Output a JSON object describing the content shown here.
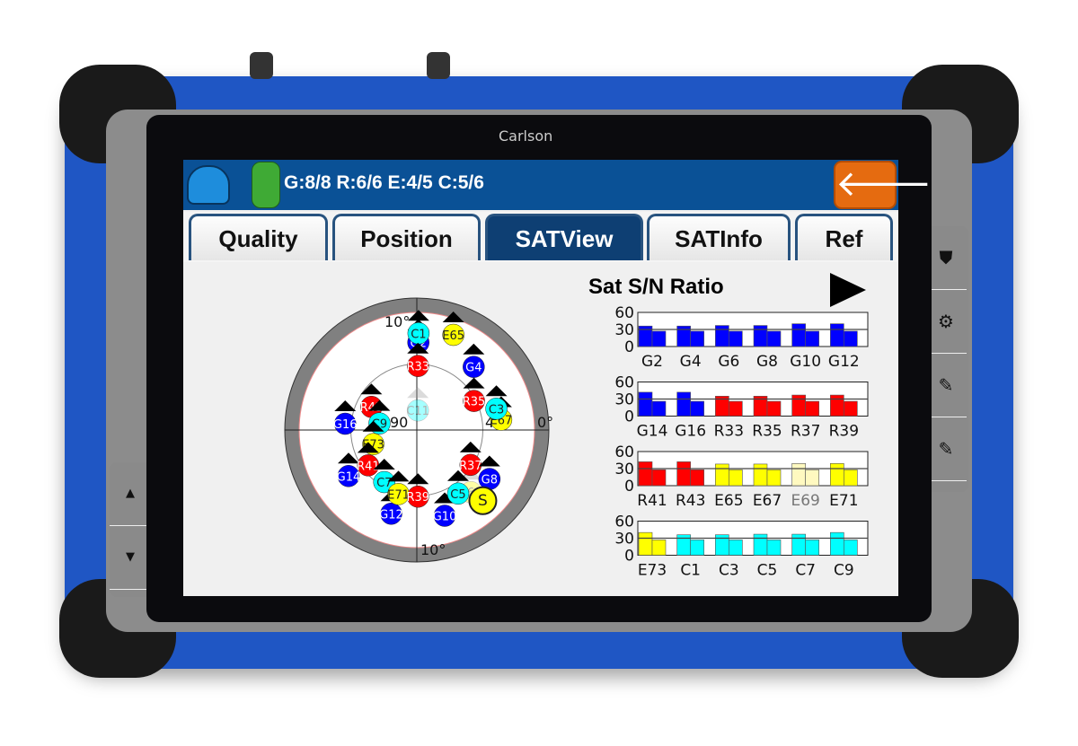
{
  "device": {
    "brand": "Carlson",
    "side_buttons": [
      {
        "icon": "shield-icon",
        "glyph": "⛊"
      },
      {
        "icon": "gear-icon",
        "glyph": "⚙"
      },
      {
        "icon": "edit-icon",
        "glyph": "✎"
      },
      {
        "icon": "edit-icon",
        "glyph": "✎"
      }
    ],
    "nav_buttons": [
      {
        "icon": "arrow-up-icon",
        "glyph": "▲"
      },
      {
        "icon": "arrow-down-icon",
        "glyph": "▼"
      }
    ]
  },
  "header": {
    "status": "G:8/8 R:6/6 E:4/5 C:5/6",
    "back_glyph": "🡐",
    "color": "#0a5196"
  },
  "tabs": [
    {
      "label": "Quality"
    },
    {
      "label": "Position"
    },
    {
      "label": "SATView",
      "active": true
    },
    {
      "label": "SATInfo"
    },
    {
      "label": "Ref"
    }
  ],
  "skyplot": {
    "labels": {
      "top": "10°",
      "bottom": "10°",
      "right": "0°",
      "center": "90",
      "inner": "45"
    },
    "colors": {
      "G": "#0000ff",
      "R": "#ff0000",
      "E": "#ffff00",
      "C": "#00ffff",
      "S": "#ffff00"
    },
    "satellites": [
      {
        "id": "G2",
        "az": 1,
        "el": 23
      },
      {
        "id": "C1",
        "az": 1,
        "el": 16
      },
      {
        "id": "E65",
        "az": 21,
        "el": 12
      },
      {
        "id": "R33",
        "az": 1,
        "el": 41
      },
      {
        "id": "G4",
        "az": 42,
        "el": 25
      },
      {
        "id": "R35",
        "az": 63,
        "el": 41
      },
      {
        "id": "E67",
        "az": 83,
        "el": 25
      },
      {
        "id": "C3",
        "az": 75,
        "el": 27
      },
      {
        "id": "C11",
        "az": 3,
        "el": 75,
        "faded": true
      },
      {
        "id": "G16",
        "az": 275,
        "el": 35
      },
      {
        "id": "R43",
        "az": 297,
        "el": 51
      },
      {
        "id": "C9",
        "az": 280,
        "el": 61
      },
      {
        "id": "E73",
        "az": 252,
        "el": 55
      },
      {
        "id": "G14",
        "az": 236,
        "el": 27
      },
      {
        "id": "R41",
        "az": 234,
        "el": 44
      },
      {
        "id": "C7",
        "az": 212,
        "el": 43
      },
      {
        "id": "G12",
        "az": 197,
        "el": 23
      },
      {
        "id": "E71",
        "az": 196,
        "el": 39
      },
      {
        "id": "R39",
        "az": 179,
        "el": 39
      },
      {
        "id": "G10",
        "az": 162,
        "el": 21
      },
      {
        "id": "E69",
        "az": 139,
        "el": 27,
        "faded": true
      },
      {
        "id": "C5",
        "az": 147,
        "el": 32
      },
      {
        "id": "R37",
        "az": 123,
        "el": 41
      },
      {
        "id": "G8",
        "az": 124,
        "el": 23
      },
      {
        "id": "S",
        "az": 137,
        "el": 16,
        "sbas": true
      }
    ]
  },
  "sn_chart": {
    "title": "Sat S/N Ratio",
    "next_glyph": "▶"
  },
  "chart_data": {
    "type": "bar",
    "title": "Sat S/N Ratio",
    "yticks": [
      0,
      30,
      60
    ],
    "ylim": [
      0,
      60
    ],
    "reference_line": 30,
    "panels": [
      {
        "categories": [
          "G2",
          "G4",
          "G6",
          "G8",
          "G10",
          "G12"
        ],
        "system": "G",
        "values_l1": [
          36,
          36,
          37,
          37,
          40,
          40
        ],
        "values_l2": [
          27,
          27,
          27,
          27,
          27,
          27
        ]
      },
      {
        "categories": [
          "G14",
          "G16",
          "R33",
          "R35",
          "R37",
          "R39"
        ],
        "systems": [
          "G",
          "G",
          "R",
          "R",
          "R",
          "R"
        ],
        "values_l1": [
          42,
          42,
          35,
          35,
          37,
          37
        ],
        "values_l2": [
          26,
          26,
          26,
          26,
          26,
          26
        ]
      },
      {
        "categories": [
          "R41",
          "R43",
          "E65",
          "E67",
          "E69",
          "E71"
        ],
        "systems": [
          "R",
          "R",
          "E",
          "E",
          "E",
          "E"
        ],
        "faded": [
          "E69"
        ],
        "values_l1": [
          42,
          42,
          38,
          38,
          39,
          39
        ],
        "values_l2": [
          28,
          28,
          28,
          28,
          28,
          28
        ]
      },
      {
        "categories": [
          "E73",
          "C1",
          "C3",
          "C5",
          "C7",
          "C9"
        ],
        "systems": [
          "E",
          "C",
          "C",
          "C",
          "C",
          "C"
        ],
        "values_l1": [
          40,
          36,
          36,
          37,
          37,
          40
        ],
        "values_l2": [
          27,
          27,
          27,
          27,
          27,
          27
        ]
      }
    ]
  }
}
